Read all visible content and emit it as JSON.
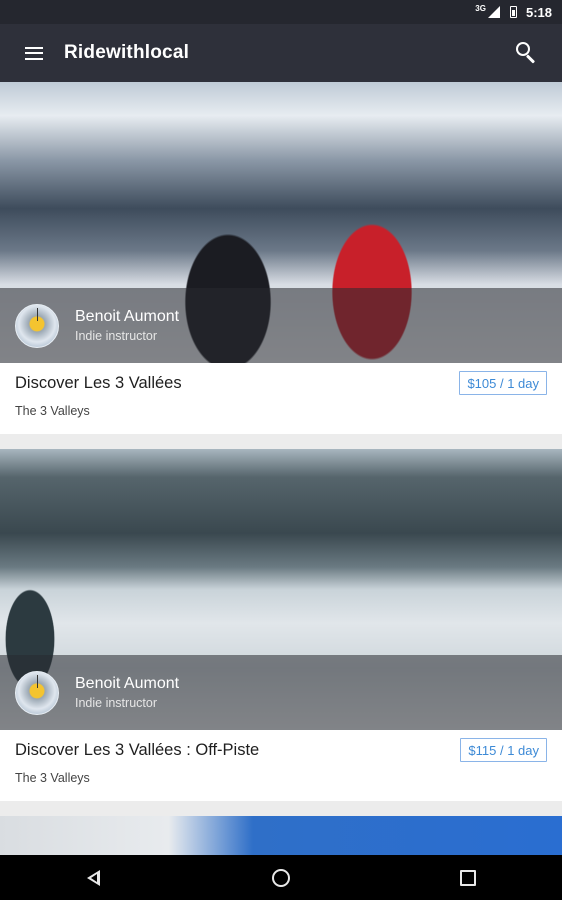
{
  "status_bar": {
    "network": "3G",
    "time": "5:18"
  },
  "app_bar": {
    "title": "Ridewithlocal"
  },
  "cards": [
    {
      "instructor_name": "Benoit Aumont",
      "instructor_role": "Indie instructor",
      "title": "Discover Les 3 Vallées",
      "location": "The 3 Valleys",
      "price": "$105 / 1 day"
    },
    {
      "instructor_name": "Benoit Aumont",
      "instructor_role": "Indie instructor",
      "title": "Discover Les 3 Vallées : Off-Piste",
      "location": "The 3 Valleys",
      "price": "$115 / 1 day"
    }
  ],
  "colors": {
    "app_bar": "#2e303a",
    "status_bar": "#25272f",
    "price_accent": "#3d8ad6"
  }
}
